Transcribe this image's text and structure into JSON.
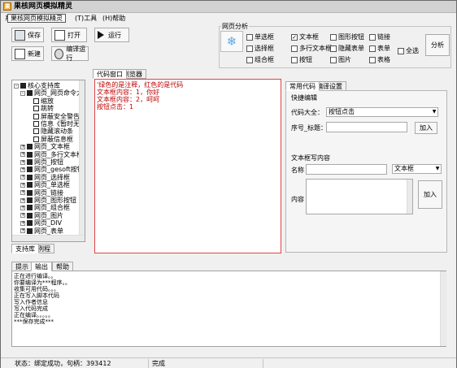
{
  "window": {
    "title": "果核网页模拟精灵",
    "app_icon": "果"
  },
  "menu": {
    "items": [
      "系统(S)",
      "果核网页模拟精灵",
      "工具",
      "帮助"
    ],
    "tool_label": "(T)工具",
    "help_label": "(H)帮助"
  },
  "toolbar": {
    "save": "保存",
    "open": "打开",
    "run": "运行",
    "new": "新建",
    "compile_run": "编译运行"
  },
  "analysis": {
    "group_title": "网页分析",
    "checkboxes": [
      {
        "label": "单选框",
        "checked": false
      },
      {
        "label": "文本框",
        "checked": true
      },
      {
        "label": "图形按钮",
        "checked": false
      },
      {
        "label": "链接",
        "checked": false
      },
      {
        "label": "选择框",
        "checked": false
      },
      {
        "label": "多行文本框",
        "checked": false
      },
      {
        "label": "隐藏表单",
        "checked": false
      },
      {
        "label": "表单",
        "checked": false
      },
      {
        "label": "全选",
        "checked": false
      },
      {
        "label": "组合框",
        "checked": false
      },
      {
        "label": "按钮",
        "checked": false
      },
      {
        "label": "图片",
        "checked": false
      },
      {
        "label": "表格",
        "checked": false
      }
    ],
    "analyze_button": "分析"
  },
  "tree": {
    "items": [
      {
        "label": "核心支持库",
        "exp": "-",
        "level": 0
      },
      {
        "label": "网页_网页命令大全",
        "exp": "-",
        "level": 1
      },
      {
        "label": "缩放",
        "exp": "",
        "level": 2
      },
      {
        "label": "跳转",
        "exp": "",
        "level": 2
      },
      {
        "label": "屏蔽安全警告",
        "exp": "",
        "level": 2
      },
      {
        "label": "信息《暂时无用",
        "exp": "",
        "level": 2
      },
      {
        "label": "隐藏滚动条",
        "exp": "",
        "level": 2
      },
      {
        "label": "屏蔽信息框",
        "exp": "",
        "level": 2
      },
      {
        "label": "网页_文本框",
        "exp": "+",
        "level": 1
      },
      {
        "label": "网页_多行文本框",
        "exp": "+",
        "level": 1
      },
      {
        "label": "网页_按钮",
        "exp": "+",
        "level": 1
      },
      {
        "label": "网页_gesoft按钮",
        "exp": "+",
        "level": 1
      },
      {
        "label": "网页_选择框",
        "exp": "+",
        "level": 1
      },
      {
        "label": "网页_单选框",
        "exp": "+",
        "level": 1
      },
      {
        "label": "网页_链接",
        "exp": "+",
        "level": 1
      },
      {
        "label": "网页_图形按钮",
        "exp": "+",
        "level": 1
      },
      {
        "label": "网页_组合框",
        "exp": "+",
        "level": 1
      },
      {
        "label": "网页_图片",
        "exp": "+",
        "level": 1
      },
      {
        "label": "网页_DIV",
        "exp": "+",
        "level": 1
      },
      {
        "label": "网页_表单",
        "exp": "+",
        "level": 1
      }
    ]
  },
  "left_tabs": [
    "支持库",
    "例程"
  ],
  "code_tabs": [
    "代码窗口",
    "浏览器"
  ],
  "code_lines": [
    {
      "text": "'绿色的是注释，红色的是代码",
      "color": "#c00000"
    },
    {
      "text": "文本框内容：1，你好",
      "color": "#c00000"
    },
    {
      "text": "文本框内容：2，呵呵",
      "color": "#c00000"
    },
    {
      "text": "按钮点击：1",
      "color": "#c00000"
    }
  ],
  "right_panel": {
    "tabs": [
      "常用代码",
      "编译设置"
    ],
    "quick_edit": "快捷编辑",
    "code_lib_label": "代码大全：",
    "code_lib_value": "按钮点击",
    "index_label": "序号_标题：",
    "add_button": "加入",
    "textbox_content_title": "文本框写内容",
    "name_label": "名称",
    "type_value": "文本框",
    "content_label": "内容",
    "add_button2": "加入"
  },
  "output_tabs": [
    "提示",
    "输出",
    "帮助"
  ],
  "output_lines": [
    "正在进行编译。。",
    "你要编译为***程序。。",
    "收集可用代码。。。",
    "正在写入脚本代码",
    "写入作者信息",
    "写入代码完成",
    "正在编译。。。。。",
    "***保存完成***"
  ],
  "status": {
    "left": "状态：绑定成功，句柄：393412",
    "right": "完成"
  }
}
